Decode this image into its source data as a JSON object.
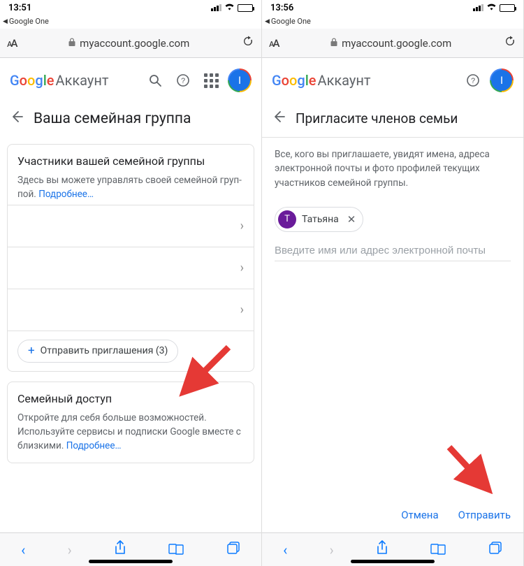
{
  "left": {
    "status": {
      "time": "13:51",
      "breadcrumb": "Google One"
    },
    "url": {
      "host": "myaccount.google.com"
    },
    "header": {
      "logo_suffix": "Аккаунт",
      "avatar_initial": "I"
    },
    "page_title": "Ваша семейная группа",
    "card1": {
      "title": "Участники вашей семейной группы",
      "desc_prefix": "Здесь вы можете управлять своей семейной груп­пой. ",
      "learn_more": "Подробнее…",
      "invite_label": "Отправить приглашения (3)"
    },
    "card2": {
      "title": "Семейный доступ",
      "desc_prefix": "Откройте для себя больше возможностей. Исполь­зуйте сервисы и подписки Google вместе с близки­ми. ",
      "learn_more": "Подробнее…"
    }
  },
  "right": {
    "status": {
      "time": "13:56",
      "breadcrumb": "Google One"
    },
    "url": {
      "host": "myaccount.google.com"
    },
    "header": {
      "logo_suffix": "Аккаунт",
      "avatar_initial": "I"
    },
    "page_title": "Пригласите членов семьи",
    "info": "Все, кого вы приглашаете, увидят имена, адреса электронной почты и фото профилей текущих участников семейной группы.",
    "contact": {
      "initial": "Т",
      "name": "Татьяна"
    },
    "input_placeholder": "Введите имя или адрес электронной почты",
    "actions": {
      "cancel": "Отмена",
      "send": "Отправить"
    }
  },
  "aa_label": "ᴀA"
}
